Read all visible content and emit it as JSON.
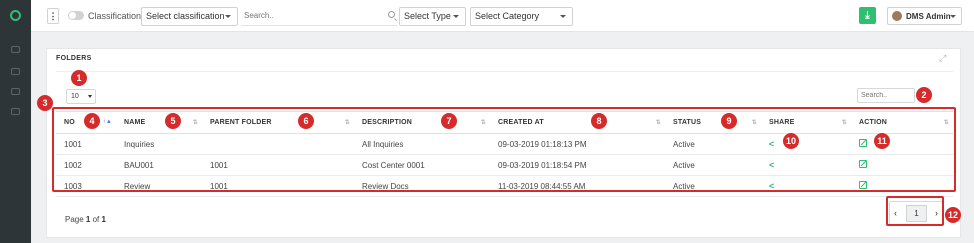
{
  "topbar": {
    "classification_label": "Classification",
    "classification_select": "Select classification",
    "search_placeholder": "Search..",
    "type_select": "Select Type",
    "category_select": "Select Category",
    "user_name": "DMS Admin"
  },
  "panel": {
    "title": "FOLDERS",
    "page_length": "10",
    "search_placeholder": "Search..",
    "columns": [
      "NO",
      "NAME",
      "PARENT FOLDER",
      "DESCRIPTION",
      "CREATED AT",
      "STATUS",
      "SHARE",
      "ACTION"
    ],
    "rows": [
      {
        "no": "1001",
        "name": "Inquiries",
        "parent": "",
        "description": "All Inquiries",
        "created": "09-03-2019 01:18:13 PM",
        "status": "Active"
      },
      {
        "no": "1002",
        "name": "BAU001",
        "parent": "1001",
        "description": "Cost Center 0001",
        "created": "09-03-2019 01:18:54 PM",
        "status": "Active"
      },
      {
        "no": "1003",
        "name": "Review",
        "parent": "1001",
        "description": "Review Docs",
        "created": "11-03-2019 08:44:55 AM",
        "status": "Active"
      }
    ],
    "page_text_prefix": "Page",
    "page_current": "1",
    "page_of": "of",
    "page_total": "1",
    "pager_current": "1",
    "pager_prev": "‹",
    "pager_next": "›"
  },
  "annotations": [
    "1",
    "2",
    "3",
    "4",
    "5",
    "6",
    "7",
    "8",
    "9",
    "10",
    "11",
    "12"
  ],
  "colors": {
    "accent_green": "#2fbf71",
    "annotation_red": "#d62b2b",
    "sidebar": "#2d3538"
  },
  "icons": {
    "share": "share-icon",
    "action": "edit-icon",
    "download": "download-icon",
    "expand": "expand-icon"
  }
}
